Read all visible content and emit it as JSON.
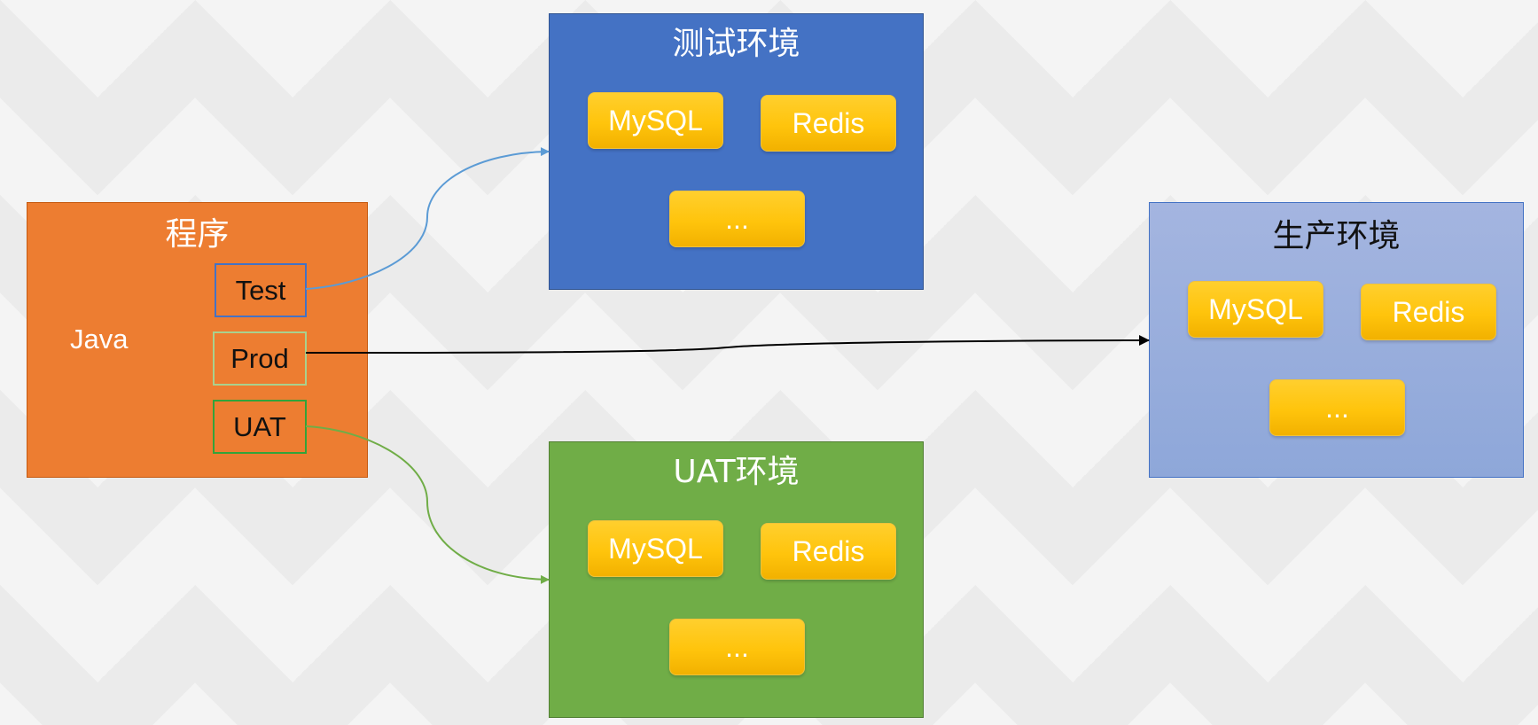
{
  "program": {
    "title": "程序",
    "language": "Java",
    "profiles": {
      "test": "Test",
      "prod": "Prod",
      "uat": "UAT"
    }
  },
  "environments": {
    "test": {
      "title": "测试环境",
      "services": [
        "MySQL",
        "Redis",
        "..."
      ]
    },
    "uat": {
      "title": "UAT环境",
      "services": [
        "MySQL",
        "Redis",
        "..."
      ]
    },
    "prod": {
      "title": "生产环境",
      "services": [
        "MySQL",
        "Redis",
        "..."
      ]
    }
  },
  "colors": {
    "program": "#ed7d31",
    "test_env": "#4472c4",
    "uat_env": "#70ad47",
    "prod_env": "#8faadc",
    "service": "#ffc000",
    "test_link": "#5b9bd5",
    "uat_link": "#70ad47",
    "prod_link": "#000000"
  }
}
